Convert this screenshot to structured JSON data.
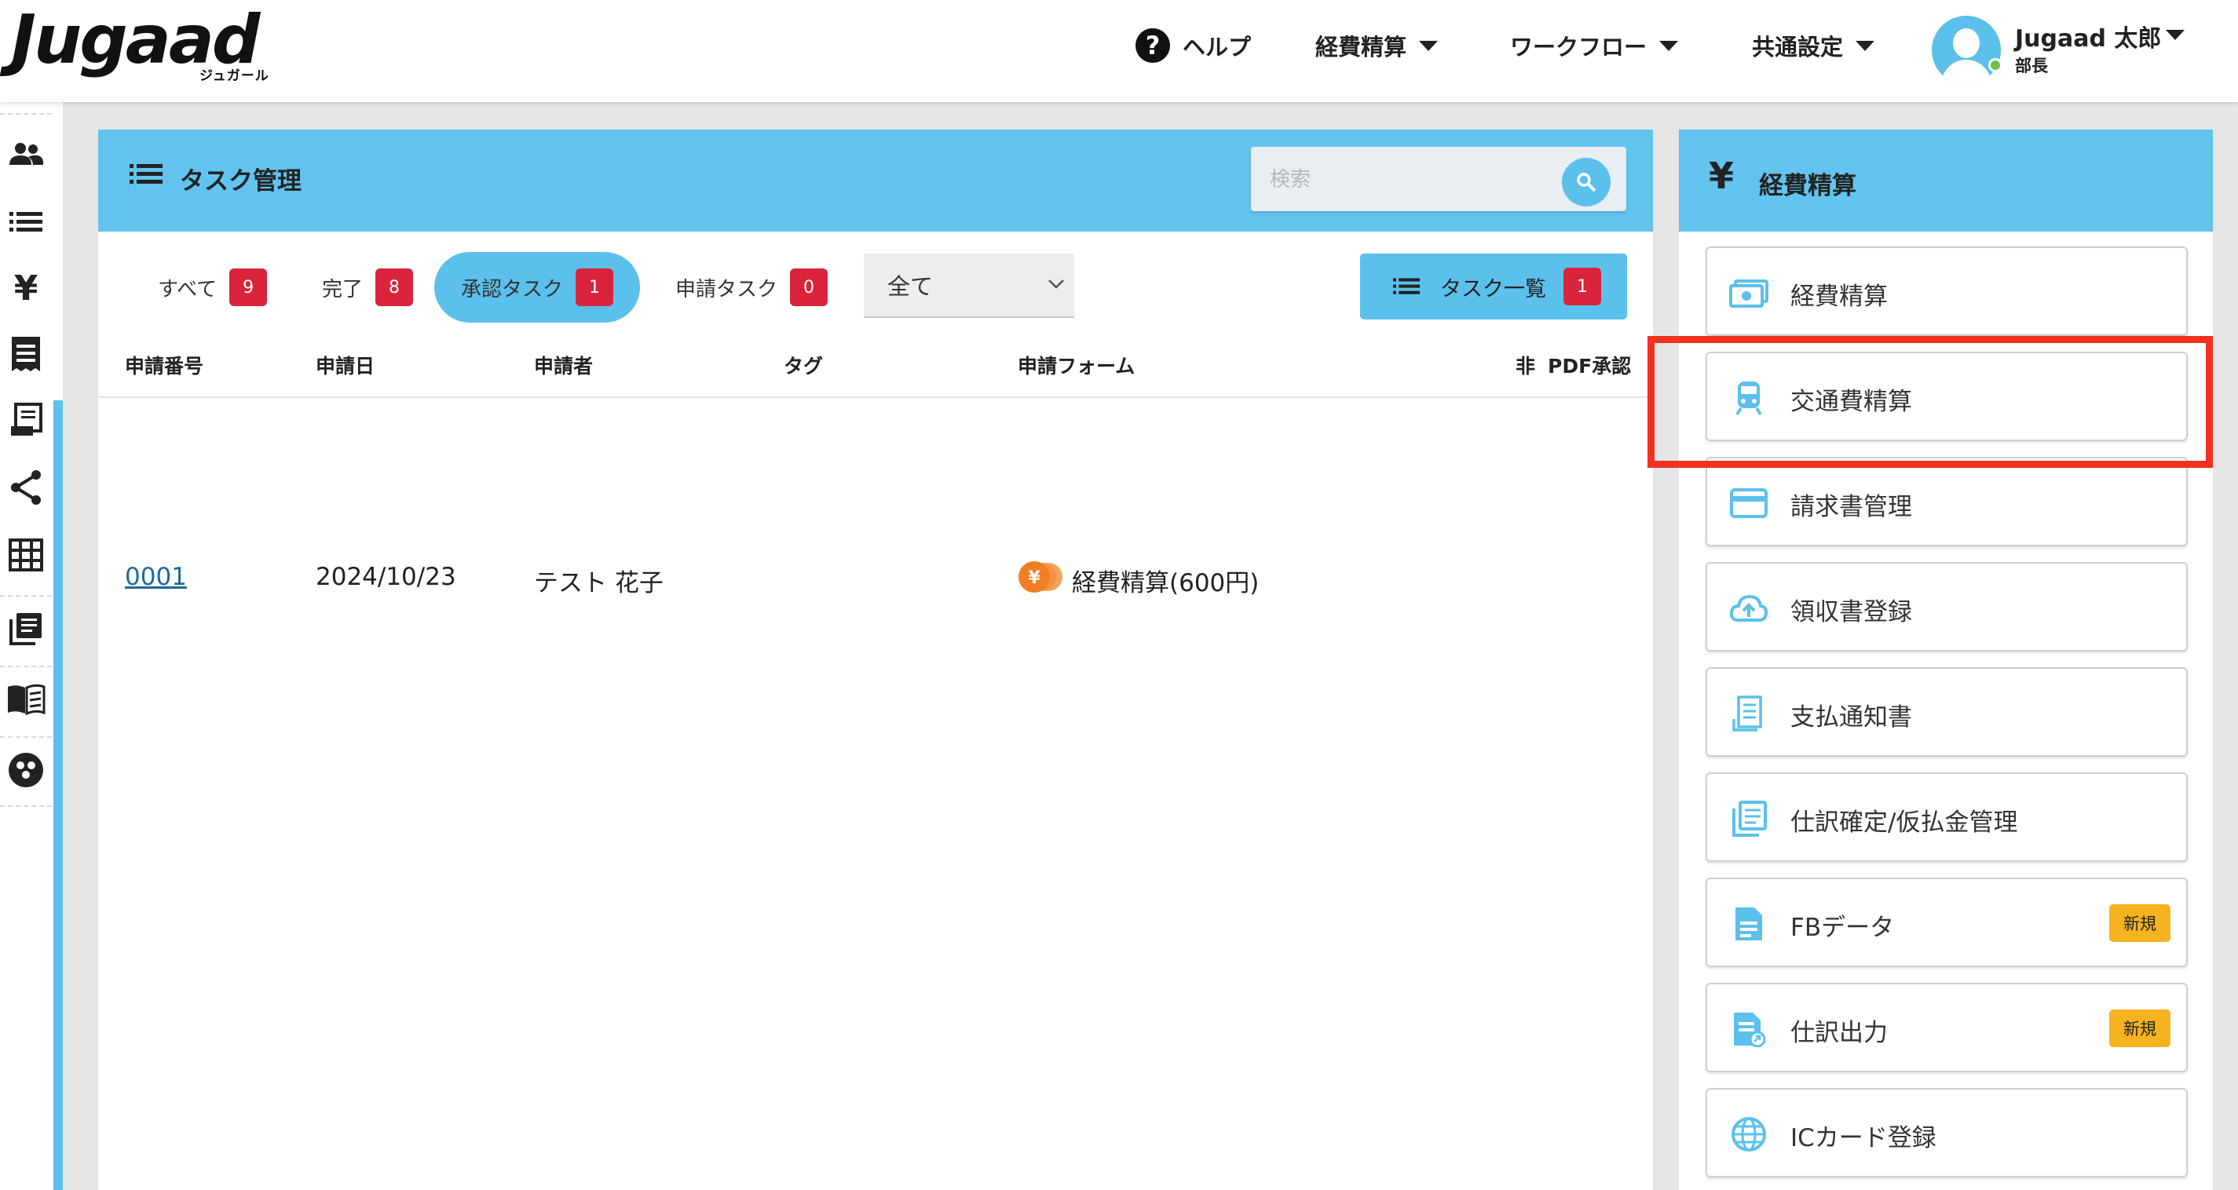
{
  "app": {
    "logo_text": "Jugaad",
    "logo_sub": "ジュガール"
  },
  "header": {
    "help": "ヘルプ",
    "nav": [
      "経費精算",
      "ワークフロー",
      "共通設定"
    ],
    "user_name": "Jugaad 太郎",
    "user_role": "部長"
  },
  "rail": {
    "icons": [
      "people-icon",
      "list-icon",
      "yen-icon",
      "receipt-icon",
      "invoice-icon",
      "share-icon",
      "grid-icon",
      "library-icon",
      "book-icon",
      "community-icon"
    ]
  },
  "task_panel": {
    "title": "タスク管理",
    "search_placeholder": "検索",
    "tabs": [
      {
        "label": "すべて",
        "count": "9"
      },
      {
        "label": "完了",
        "count": "8"
      },
      {
        "label": "承認タスク",
        "count": "1",
        "active": true
      },
      {
        "label": "申請タスク",
        "count": "0"
      }
    ],
    "filter_value": "全て",
    "task_list_label": "タスク一覧",
    "task_list_count": "1",
    "columns": [
      "申請番号",
      "申請日",
      "申請者",
      "タグ",
      "申請フォーム",
      "非",
      "PDF承認"
    ],
    "rows": [
      {
        "number": "0001",
        "date": "2024/10/23",
        "applicant": "テスト 花子",
        "tag": "",
        "form": "経費精算(600円)"
      }
    ]
  },
  "expense_panel": {
    "title": "経費精算",
    "yen_symbol": "¥",
    "items": [
      {
        "label": "経費精算",
        "icon": "money-icon",
        "badge": ""
      },
      {
        "label": "交通費精算",
        "icon": "train-icon",
        "badge": "",
        "highlighted": true
      },
      {
        "label": "請求書管理",
        "icon": "credit-card-icon",
        "badge": ""
      },
      {
        "label": "領収書登録",
        "icon": "cloud-upload-icon",
        "badge": ""
      },
      {
        "label": "支払通知書",
        "icon": "receipt-icon",
        "badge": ""
      },
      {
        "label": "仕訳確定/仮払金管理",
        "icon": "documents-icon",
        "badge": ""
      },
      {
        "label": "FBデータ",
        "icon": "file-data-icon",
        "badge": "新規"
      },
      {
        "label": "仕訳出力",
        "icon": "file-export-icon",
        "badge": "新規"
      },
      {
        "label": "ICカード登録",
        "icon": "globe-icon",
        "badge": ""
      }
    ]
  },
  "colors": {
    "accent": "#5bc0eb",
    "panel_header": "#62c3ef",
    "badge_red": "#d9243c",
    "badge_new": "#f5b31f",
    "highlight": "#f0321e",
    "link": "#1b6a9c"
  }
}
